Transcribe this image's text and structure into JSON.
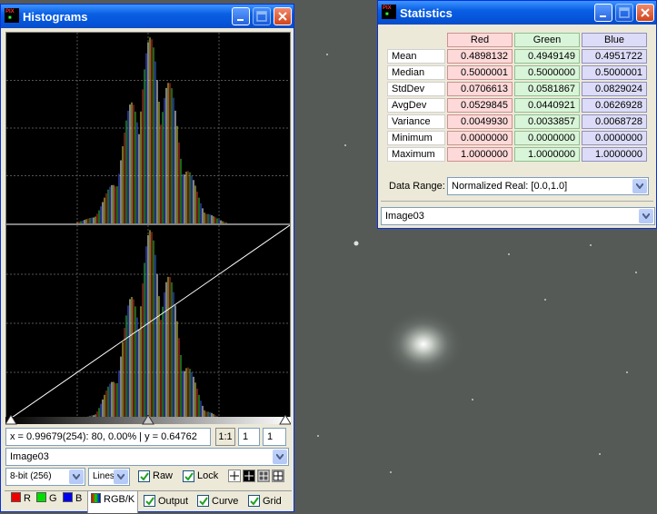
{
  "histogram_window": {
    "title": "Histograms",
    "coords_readout": "x = 0.99679(254): 80, 0.00% | y = 0.64762",
    "zoom_button": "1:1",
    "zoom_x": "1",
    "zoom_y": "1",
    "image_select": "Image03",
    "bit_depth": "8-bit (256)",
    "draw_mode": "Lines",
    "raw_label": "Raw",
    "lock_label": "Lock",
    "tabs": {
      "r": "R",
      "g": "G",
      "b": "B",
      "rgbk": "RGB/K",
      "output": "Output",
      "curve": "Curve",
      "grid": "Grid"
    }
  },
  "statistics_window": {
    "title": "Statistics",
    "columns": [
      "Red",
      "Green",
      "Blue"
    ],
    "rows": [
      {
        "label": "Mean",
        "values": [
          "0.4898132",
          "0.4949149",
          "0.4951722"
        ]
      },
      {
        "label": "Median",
        "values": [
          "0.5000001",
          "0.5000000",
          "0.5000001"
        ]
      },
      {
        "label": "StdDev",
        "values": [
          "0.0706613",
          "0.0581867",
          "0.0829024"
        ]
      },
      {
        "label": "AvgDev",
        "values": [
          "0.0529845",
          "0.0440921",
          "0.0626928"
        ]
      },
      {
        "label": "Variance",
        "values": [
          "0.0049930",
          "0.0033857",
          "0.0068728"
        ]
      },
      {
        "label": "Minimum",
        "values": [
          "0.0000000",
          "0.0000000",
          "0.0000000"
        ]
      },
      {
        "label": "Maximum",
        "values": [
          "1.0000000",
          "1.0000000",
          "1.0000000"
        ]
      }
    ],
    "data_range_label": "Data Range:",
    "data_range_value": "Normalized Real: [0.0,1.0]",
    "image_select": "Image03"
  },
  "colors": {
    "titlebar": "#0a5fe3",
    "window_face": "#ece9d8",
    "red_cell": "#fdd9d9",
    "green_cell": "#d9f5d9",
    "blue_cell": "#dcdcf8",
    "sky": "#555a57"
  },
  "icons": {
    "app": "pixinsight-logo-icon",
    "minimize": "minimize-icon",
    "maximize": "maximize-icon",
    "close": "close-icon"
  }
}
